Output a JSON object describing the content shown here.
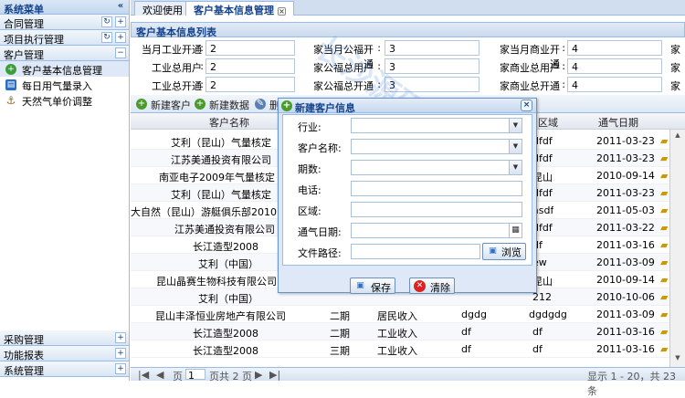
{
  "sidebar": {
    "title": "系统菜单",
    "collapse": "«",
    "sections_top": [
      {
        "label": "合同管理"
      },
      {
        "label": "项目执行管理"
      }
    ],
    "open_section": {
      "label": "客户管理",
      "btn": "−"
    },
    "items": [
      {
        "label": "客户基本信息管理",
        "icon_color": "#3b9e3b"
      },
      {
        "label": "每日用气量录入",
        "icon_color": "#2a6fc5"
      },
      {
        "label": "天然气单价调整",
        "icon_color": "#8a6a2a"
      }
    ],
    "sections_bottom": [
      {
        "label": "采购管理"
      },
      {
        "label": "功能报表"
      },
      {
        "label": "系统管理"
      }
    ],
    "plus": "+"
  },
  "tabs": [
    {
      "label": "欢迎使用"
    },
    {
      "label": "客户基本信息管理",
      "close": "×"
    }
  ],
  "panel_title": "客户基本信息列表",
  "stats": [
    [
      {
        "label": "当月工业开通",
        "value": "2"
      },
      {
        "label": "家当月公福开通",
        "value": "3"
      },
      {
        "label": "家当月商业开通",
        "value": "4"
      },
      {
        "label": "家"
      }
    ],
    [
      {
        "label": "工业总用户",
        "value": "2"
      },
      {
        "label": "家公福总用户",
        "value": "3"
      },
      {
        "label": "家商业总用户",
        "value": "4"
      },
      {
        "label": "家"
      }
    ],
    [
      {
        "label": "工业总开通",
        "value": "2"
      },
      {
        "label": "家公福总开通",
        "value": "3"
      },
      {
        "label": "家商业总开通",
        "value": "4"
      },
      {
        "label": "家"
      }
    ]
  ],
  "toolbar": {
    "new_customer": "新建客户",
    "new_data": "新建数据",
    "more": "删"
  },
  "columns": {
    "name": "客户名称",
    "region": "区域",
    "gas_date": "通气日期"
  },
  "rows": [
    {
      "name": "艾利（昆山）气量核定",
      "phase": "",
      "type": "",
      "c4": "",
      "region": "dfdf",
      "date": "2011-03-23"
    },
    {
      "name": "江苏美通投资有限公司",
      "phase": "",
      "type": "",
      "c4": "",
      "region": "dfdf",
      "date": "2011-03-23"
    },
    {
      "name": "南亚电子2009年气量核定",
      "phase": "",
      "type": "",
      "c4": "",
      "region": "昆山",
      "date": "2010-09-14"
    },
    {
      "name": "艾利（昆山）气量核定",
      "phase": "",
      "type": "",
      "c4": "",
      "region": "dfdf",
      "date": "2011-03-23"
    },
    {
      "name": "大自然（昆山）游艇俱乐部2010年",
      "phase": "",
      "type": "",
      "c4": "",
      "region": "asdf",
      "date": "2011-05-03"
    },
    {
      "name": "江苏美通投资有限公司",
      "phase": "",
      "type": "",
      "c4": "",
      "region": "dfdf",
      "date": "2011-03-22"
    },
    {
      "name": "长江造型2008",
      "phase": "",
      "type": "",
      "c4": "",
      "region": "df",
      "date": "2011-03-16"
    },
    {
      "name": "艾利（中国）",
      "phase": "",
      "type": "",
      "c4": "",
      "region": "ew",
      "date": "2011-03-09"
    },
    {
      "name": "昆山晶赛生物科技有限公司",
      "phase": "",
      "type": "",
      "c4": "",
      "region": "昆山",
      "date": "2010-09-14"
    },
    {
      "name": "艾利（中国）",
      "phase": "",
      "type": "",
      "c4": "",
      "region": "212",
      "date": "2010-10-06"
    },
    {
      "name": "昆山丰泽恒业房地产有限公司",
      "phase": "二期",
      "type": "居民收入",
      "c4": "dgdg",
      "region": "dgdgdg",
      "date": "2011-03-09"
    },
    {
      "name": "长江造型2008",
      "phase": "二期",
      "type": "工业收入",
      "c4": "df",
      "region": "df",
      "date": "2011-03-16"
    },
    {
      "name": "长江造型2008",
      "phase": "三期",
      "type": "工业收入",
      "c4": "df",
      "region": "df",
      "date": "2011-03-16"
    }
  ],
  "pager": {
    "page_label": "页",
    "page": "1",
    "total": "页共 2 页",
    "info": "显示 1 - 20，共 23 条"
  },
  "modal": {
    "title": "新建客户信息",
    "close": "×",
    "fields": {
      "industry": "行业:",
      "customer_name": "客户名称:",
      "period": "期数:",
      "phone": "电话:",
      "region": "区域:",
      "gas_date": "通气日期:",
      "file_path": "文件路径:"
    },
    "browse": "浏览",
    "save": "保存",
    "clear": "清除"
  },
  "watermark": {
    "text": "长沙源码淘宝店"
  }
}
